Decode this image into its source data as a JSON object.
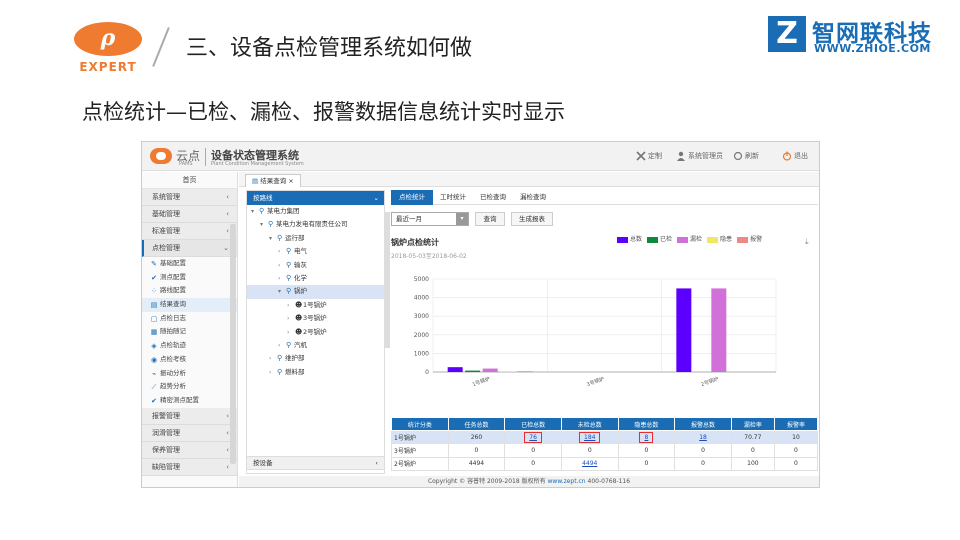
{
  "slide": {
    "logo_left_mark": "ρ",
    "logo_left_word": "EXPERT",
    "title": "三、设备点检管理系统如何做",
    "logo_right_mark": "Z",
    "logo_right_cn": "智网联科技",
    "logo_right_url": "WWW.ZHIOE.COM",
    "subtitle": "点检统计—已检、漏检、报警数据信息统计实时显示"
  },
  "app": {
    "brand_name": "云点",
    "brand_pams": "PAMS",
    "brand_title": "设备状态管理系统",
    "brand_sub": "Plant Condition Management System",
    "top_links": [
      {
        "label": "定制",
        "icon": "tools-icon"
      },
      {
        "label": "系统管理员",
        "icon": "user-icon"
      },
      {
        "label": "刷新",
        "icon": "refresh-icon"
      },
      {
        "label": "退出",
        "icon": "power-icon"
      }
    ],
    "sidebar": {
      "home": "首页",
      "groups_top": [
        "系统管理",
        "基础管理",
        "标准管理"
      ],
      "open_group": "点检管理",
      "sub_items": [
        "基础配置",
        "测点配置",
        "路线配置",
        "结果查询",
        "点检日志",
        "随拍随记",
        "点检轨迹",
        "点检考核",
        "振动分析",
        "趋势分析",
        "精密测点配置"
      ],
      "sub_icons": [
        "✎",
        "✔",
        "⁘",
        "▤",
        "▢",
        "▦",
        "◈",
        "◉",
        "⌁",
        "⟋",
        "✔"
      ],
      "groups_bottom": [
        "报警管理",
        "润滑管理",
        "保养管理",
        "缺陷管理"
      ]
    },
    "tab": {
      "label": "结果查询",
      "close": "×"
    },
    "tree": {
      "header": "按路线",
      "footer": "按设备",
      "nodes": [
        {
          "label": "某电力集团",
          "level": 0,
          "toggle": "▾",
          "icon": "org"
        },
        {
          "label": "某电力发电有限责任公司",
          "level": 1,
          "toggle": "▾",
          "icon": "org"
        },
        {
          "label": "运行部",
          "level": 2,
          "toggle": "▾",
          "icon": "org"
        },
        {
          "label": "电气",
          "level": 3,
          "toggle": "›",
          "icon": "org"
        },
        {
          "label": "输灰",
          "level": 3,
          "toggle": "›",
          "icon": "org"
        },
        {
          "label": "化学",
          "level": 3,
          "toggle": "›",
          "icon": "org"
        },
        {
          "label": "锅炉",
          "level": 3,
          "toggle": "▾",
          "icon": "org",
          "selected": true
        },
        {
          "label": "1号锅炉",
          "level": 4,
          "toggle": "›",
          "icon": "person"
        },
        {
          "label": "3号锅炉",
          "level": 4,
          "toggle": "›",
          "icon": "person"
        },
        {
          "label": "2号锅炉",
          "level": 4,
          "toggle": "›",
          "icon": "person"
        },
        {
          "label": "汽机",
          "level": 3,
          "toggle": "›",
          "icon": "org"
        },
        {
          "label": "维护部",
          "level": 2,
          "toggle": "›",
          "icon": "org"
        },
        {
          "label": "燃料部",
          "level": 2,
          "toggle": "›",
          "icon": "org"
        }
      ]
    },
    "sub_tabs": [
      "点检统计",
      "工时统计",
      "已检查询",
      "漏检查询"
    ],
    "range_value": "最近一月",
    "query_btn": "查询",
    "report_btn": "生成报表",
    "table": {
      "headers": [
        "统计分类",
        "任务总数",
        "已检总数",
        "未检总数",
        "隐患总数",
        "报警总数",
        "漏检率",
        "报警率"
      ],
      "rows": [
        [
          "1号锅炉",
          "260",
          "76",
          "184",
          "8",
          "18",
          "70.77",
          "10"
        ],
        [
          "3号锅炉",
          "0",
          "0",
          "0",
          "0",
          "0",
          "0",
          "0"
        ],
        [
          "2号锅炉",
          "4494",
          "0",
          "4494",
          "0",
          "0",
          "100",
          "0"
        ]
      ]
    },
    "footer": {
      "copyright": "Copyright © 容普特 2009-2018 版权所有",
      "site": "www.zept.cn",
      "phone": "400-0768-116"
    }
  },
  "chart_data": {
    "type": "bar",
    "title": "锅炉点检统计",
    "subtitle": "2018-05-03至2018-06-02",
    "categories": [
      "1号锅炉",
      "3号锅炉",
      "2号锅炉"
    ],
    "series": [
      {
        "name": "总数",
        "color": "#5b00ff",
        "values": [
          260,
          0,
          4494
        ]
      },
      {
        "name": "已检",
        "color": "#0d8a3a",
        "values": [
          76,
          0,
          0
        ]
      },
      {
        "name": "漏检",
        "color": "#d070d8",
        "values": [
          184,
          0,
          4494
        ]
      },
      {
        "name": "隐患",
        "color": "#f0e860",
        "values": [
          8,
          0,
          0
        ]
      },
      {
        "name": "报警",
        "color": "#f08888",
        "values": [
          18,
          0,
          0
        ]
      }
    ],
    "yticks": [
      0,
      1000,
      2000,
      3000,
      4000,
      5000
    ],
    "ylim": [
      0,
      5000
    ],
    "grid": true,
    "legend": "top-right"
  }
}
